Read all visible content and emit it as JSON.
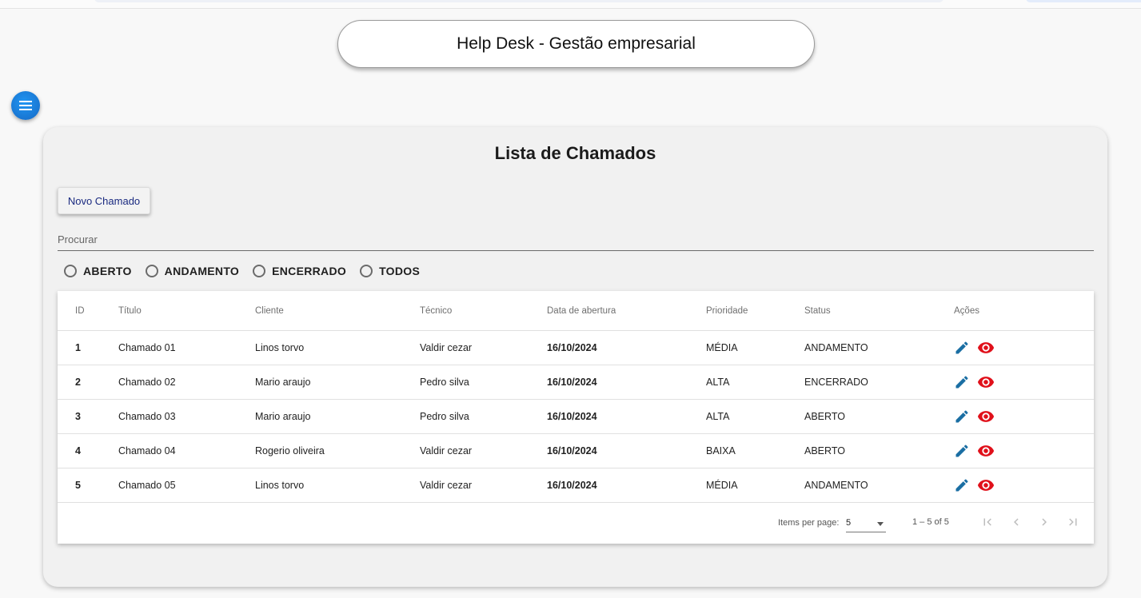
{
  "header": {
    "app_title": "Help Desk - Gestão empresarial"
  },
  "menu_fab": {
    "icon": "menu-icon",
    "color": "#1976d2"
  },
  "card": {
    "title": "Lista de Chamados",
    "new_button_label": "Novo Chamado",
    "search_placeholder": "Procurar",
    "filters": [
      {
        "label": "ABERTO",
        "selected": false
      },
      {
        "label": "ANDAMENTO",
        "selected": false
      },
      {
        "label": "ENCERRADO",
        "selected": false
      },
      {
        "label": "TODOS",
        "selected": false
      }
    ]
  },
  "table": {
    "columns": [
      "ID",
      "Título",
      "Cliente",
      "Técnico",
      "Data de abertura",
      "Prioridade",
      "Status",
      "Ações"
    ],
    "rows": [
      {
        "id": "1",
        "titulo": "Chamado 01",
        "cliente": "Linos torvo",
        "tecnico": "Valdir cezar",
        "data": "16/10/2024",
        "prioridade": "MÉDIA",
        "status": "ANDAMENTO"
      },
      {
        "id": "2",
        "titulo": "Chamado 02",
        "cliente": "Mario araujo",
        "tecnico": "Pedro silva",
        "data": "16/10/2024",
        "prioridade": "ALTA",
        "status": "ENCERRADO"
      },
      {
        "id": "3",
        "titulo": "Chamado 03",
        "cliente": "Mario araujo",
        "tecnico": "Pedro silva",
        "data": "16/10/2024",
        "prioridade": "ALTA",
        "status": "ABERTO"
      },
      {
        "id": "4",
        "titulo": "Chamado 04",
        "cliente": "Rogerio oliveira",
        "tecnico": "Valdir cezar",
        "data": "16/10/2024",
        "prioridade": "BAIXA",
        "status": "ABERTO"
      },
      {
        "id": "5",
        "titulo": "Chamado 05",
        "cliente": "Linos torvo",
        "tecnico": "Valdir cezar",
        "data": "16/10/2024",
        "prioridade": "MÉDIA",
        "status": "ANDAMENTO"
      }
    ],
    "action_icons": [
      "pencil-icon",
      "eye-icon"
    ],
    "edit_icon_color": "#1a6ea3",
    "view_icon_color": "#e0101a"
  },
  "paginator": {
    "items_per_page_label": "Items per page:",
    "page_size": "5",
    "range_label": "1 – 5 of 5",
    "buttons": [
      "first-page-icon",
      "previous-page-icon",
      "next-page-icon",
      "last-page-icon"
    ]
  }
}
